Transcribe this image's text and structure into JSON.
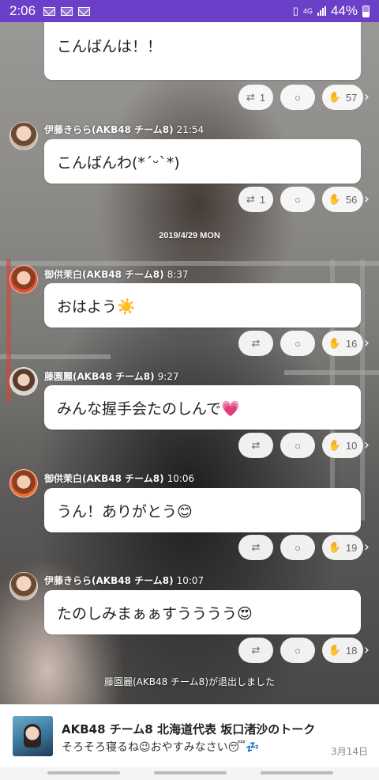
{
  "status_bar": {
    "time": "2:06",
    "network": "4G",
    "battery": "44%",
    "accent_color": "#6a40c8"
  },
  "messages": [
    {
      "sender": "",
      "time": "",
      "text": "こんばんは！！",
      "retweets": "1",
      "likes": "57"
    },
    {
      "sender": "伊藤きらら(AKB48 チーム8)",
      "time": "21:54",
      "text": "こんばんわ(*ˊᵕˋ*)",
      "retweets": "1",
      "likes": "56"
    },
    {
      "sender": "御供茉白(AKB48 チーム8)",
      "time": "8:37",
      "text": "おはよう☀️",
      "retweets": "",
      "likes": "16"
    },
    {
      "sender": "藤園麗(AKB48 チーム8)",
      "time": "9:27",
      "text": "みんな握手会たのしんで💗",
      "retweets": "",
      "likes": "10"
    },
    {
      "sender": "御供茉白(AKB48 チーム8)",
      "time": "10:06",
      "text": "うん！ありがとう😊",
      "retweets": "",
      "likes": "19"
    },
    {
      "sender": "伊藤きらら(AKB48 チーム8)",
      "time": "10:07",
      "text": "たのしみまぁぁすうううう😍",
      "retweets": "",
      "likes": "18"
    }
  ],
  "date_separator": "2019/4/29 MON",
  "system_message": "藤園麗(AKB48 チーム8)が退出しました",
  "notification": {
    "title": "AKB48 チーム8 北海道代表 坂口渚沙のトーク",
    "message": "そろそろ寝るね😉おやすみなさい😴💤",
    "date": "3月14日"
  }
}
